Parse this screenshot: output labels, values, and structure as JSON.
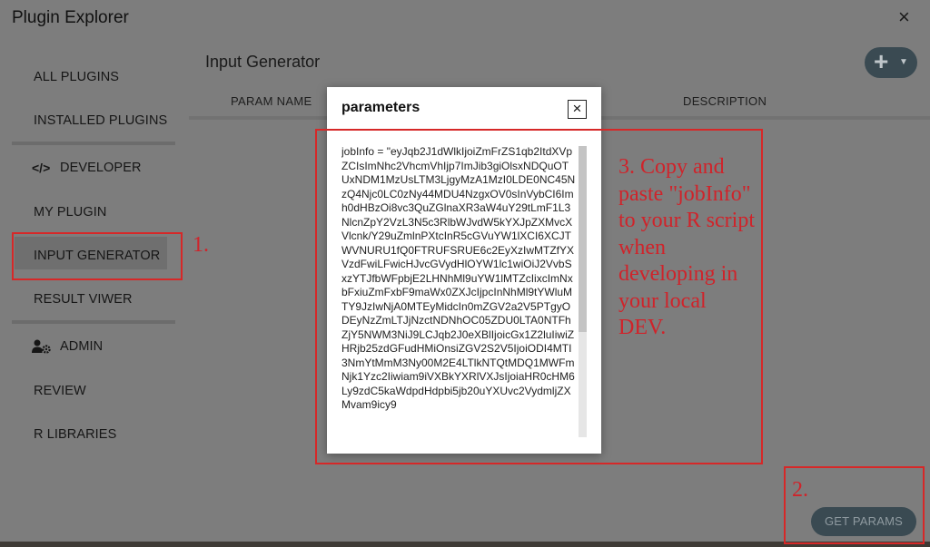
{
  "window": {
    "title": "Plugin Explorer",
    "close": "×"
  },
  "sidebar": {
    "items": [
      {
        "label": "ALL PLUGINS"
      },
      {
        "label": "INSTALLED PLUGINS"
      },
      {
        "label": "DEVELOPER",
        "icon": "code-icon",
        "icon_glyph": "</>"
      },
      {
        "label": "MY PLUGIN"
      },
      {
        "label": "INPUT GENERATOR",
        "active": true
      },
      {
        "label": "RESULT VIWER"
      },
      {
        "label": "ADMIN",
        "icon": "user-gear-icon"
      },
      {
        "label": "REVIEW"
      },
      {
        "label": "R LIBRARIES"
      }
    ]
  },
  "main": {
    "title": "Input Generator",
    "columns": [
      "PARAM NAME",
      "DESCRIPTION"
    ],
    "fab": {
      "icon": "plus-icon",
      "glyph": "+",
      "caret": "▼"
    },
    "get_params_label": "GET PARAMS"
  },
  "modal": {
    "title": "parameters",
    "close": "×",
    "content": "jobInfo = \"eyJqb2J1dWlkIjoiZmFrZS1qb2ItdXVpZCIsImNhc2VhcmVhIjp7ImJib3giOlsxNDQuOTUxNDM1MzUsLTM3LjgyMzA1MzI0LDE0NC45NzQ4Njc0LC0zNy44MDU4NzgxOV0sInVybCI6Imh0dHBzOi8vc3QuZGlnaXR3aW4uY29tLmF1L3NlcnZpY2VzL3N5c3RlbWJvdW5kYXJpZXMvcXVlcnk/Y29uZmlnPXtcInR5cGVuYW1lXCI6XCJTWVNURU1fQ0FTRUFSRUE6c2EyXzIwMTZfYXVzdFwiLFwicHJvcGVydHlOYW1lc1wiOiJ2VvbSxzYTJfbWFpbjE2LHNhMl9uYW1lMTZcIixcImNxbFxiuZmFxbF9maWx0ZXJcIjpcInNhMl9tYWluMTY9JzIwNjA0MTEyMidcIn0mZGV2a2V5PTgyODEyNzZmLTJjNzctNDNhOC05ZDU0LTA0NTFhZjY5NWM3NiJ9LCJqb2J0eXBlIjoicGx1Z2luIiwiZHRjb25zdGFudHMiOnsiZGV2S2V5IjoiODI4MTI3NmYtMmM3Ny00M2E4LTlkNTQtMDQ1MWFmNjk1Yzc2Iiwiam9iVXBkYXRlVXJsIjoiaHR0cHM6Ly9zdC5kaWdpdHdpbi5jb20uYXUvc2VydmljZXMvam9icy9"
  },
  "annotations": {
    "step1": "1.",
    "step2": "2.",
    "step3": "3. Copy and paste \"jobInfo\" to your R script when developing in your local DEV."
  },
  "colors": {
    "overlay": "#7d7d7d",
    "annotation": "#d0232a",
    "button": "#3a4a52"
  }
}
